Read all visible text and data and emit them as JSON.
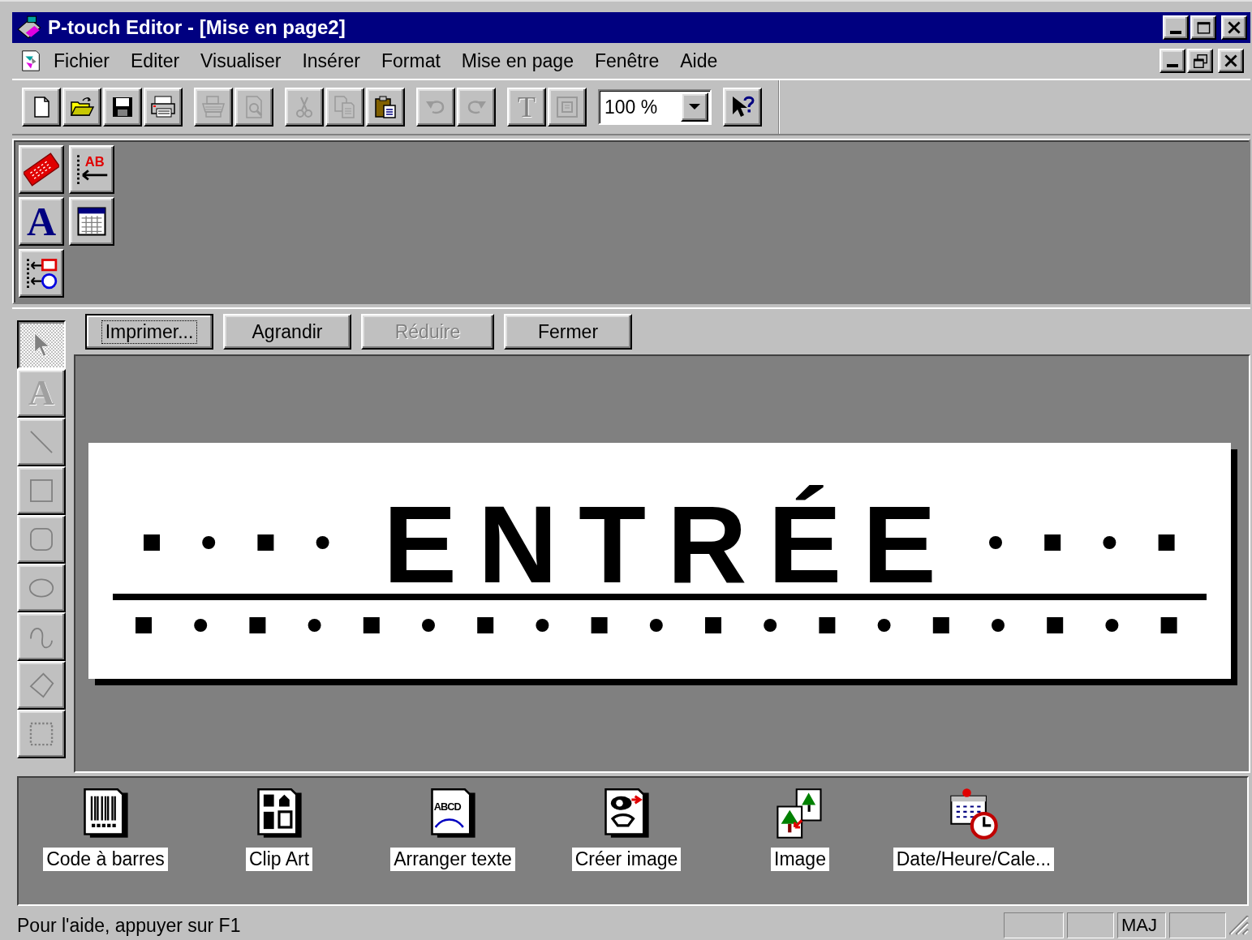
{
  "window": {
    "title": "P-touch Editor - [Mise en page2]"
  },
  "menu": [
    {
      "label": "Fichier"
    },
    {
      "label": "Editer"
    },
    {
      "label": "Visualiser"
    },
    {
      "label": "Insérer"
    },
    {
      "label": "Format"
    },
    {
      "label": "Mise en page"
    },
    {
      "label": "Fenêtre"
    },
    {
      "label": "Aide"
    }
  ],
  "toolbar": {
    "groups": [
      {
        "buttons": [
          {
            "kind": "new",
            "disabled": false
          },
          {
            "kind": "open",
            "disabled": false
          },
          {
            "kind": "save",
            "disabled": false
          },
          {
            "kind": "print-setup",
            "disabled": false
          }
        ]
      },
      {
        "buttons": [
          {
            "kind": "print",
            "disabled": true
          },
          {
            "kind": "preview",
            "disabled": true
          }
        ]
      },
      {
        "buttons": [
          {
            "kind": "cut",
            "disabled": true
          },
          {
            "kind": "copy",
            "disabled": true
          },
          {
            "kind": "paste",
            "disabled": false
          }
        ]
      },
      {
        "buttons": [
          {
            "kind": "undo",
            "disabled": true
          },
          {
            "kind": "redo",
            "disabled": true
          }
        ]
      },
      {
        "buttons": [
          {
            "kind": "text",
            "glyph": "T",
            "disabled": true
          },
          {
            "kind": "frame",
            "disabled": true
          }
        ]
      }
    ],
    "zoom": {
      "value": "100 %"
    },
    "help": {
      "kind": "help"
    }
  },
  "palette": [
    {
      "kind": "ribbon"
    },
    {
      "kind": "insert-text",
      "glyph": "AB"
    },
    {
      "kind": "font",
      "glyph": "A"
    },
    {
      "kind": "table"
    },
    {
      "kind": "layout"
    }
  ],
  "preview_buttons": [
    {
      "label": "Imprimer...",
      "focused": true,
      "disabled": false
    },
    {
      "label": "Agrandir",
      "focused": false,
      "disabled": false
    },
    {
      "label": "Réduire",
      "focused": false,
      "disabled": true
    },
    {
      "label": "Fermer",
      "focused": false,
      "disabled": false
    }
  ],
  "tools": [
    {
      "kind": "select",
      "selected": true,
      "disabled": true
    },
    {
      "kind": "text",
      "glyph": "A",
      "selected": false,
      "disabled": true
    },
    {
      "kind": "line",
      "selected": false,
      "disabled": true
    },
    {
      "kind": "rect",
      "selected": false,
      "disabled": true
    },
    {
      "kind": "roundrect",
      "selected": false,
      "disabled": true
    },
    {
      "kind": "ellipse",
      "selected": false,
      "disabled": true
    },
    {
      "kind": "curve",
      "selected": false,
      "disabled": true
    },
    {
      "kind": "polygon",
      "selected": false,
      "disabled": true
    },
    {
      "kind": "clip",
      "selected": false,
      "disabled": true
    }
  ],
  "label": {
    "text": "ENTRÉE"
  },
  "objects": [
    {
      "kind": "barcode",
      "label": "Code à barres"
    },
    {
      "kind": "clipart",
      "label": "Clip Art"
    },
    {
      "kind": "arrange",
      "glyph": "ABCD",
      "label": "Arranger texte"
    },
    {
      "kind": "create-image",
      "label": "Créer image"
    },
    {
      "kind": "image",
      "label": "Image"
    },
    {
      "kind": "datetime",
      "label": "Date/Heure/Cale..."
    }
  ],
  "status_bar": {
    "text": "Pour l'aide, appuyer sur F1",
    "caps": "MAJ"
  }
}
